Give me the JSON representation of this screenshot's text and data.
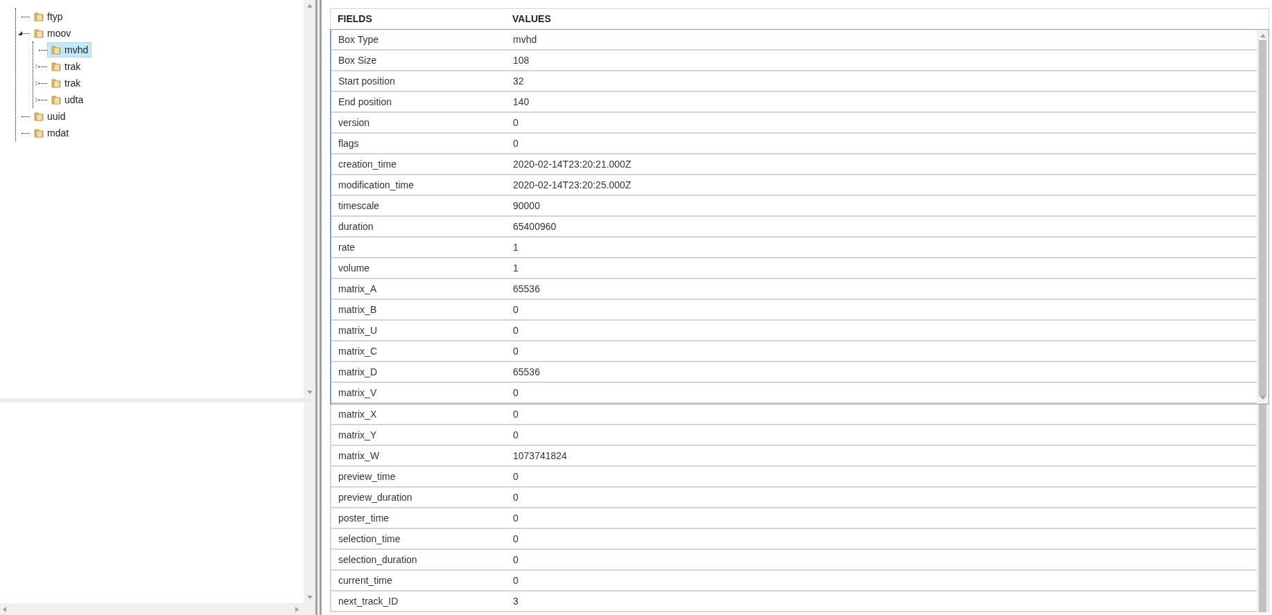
{
  "tree": [
    {
      "label": "ftyp",
      "selected": false
    },
    {
      "label": "moov",
      "selected": false,
      "expanded": true,
      "children": [
        {
          "label": "mvhd",
          "selected": true
        },
        {
          "label": "trak",
          "selected": false,
          "expanded": false
        },
        {
          "label": "trak",
          "selected": false,
          "expanded": false
        },
        {
          "label": "udta",
          "selected": false,
          "expanded": false
        }
      ]
    },
    {
      "label": "uuid",
      "selected": false
    },
    {
      "label": "mdat",
      "selected": false
    }
  ],
  "table": {
    "columns": [
      "FIELDS",
      "VALUES"
    ],
    "rows": [
      [
        "Box Type",
        "mvhd"
      ],
      [
        "Box Size",
        "108"
      ],
      [
        "Start position",
        "32"
      ],
      [
        "End position",
        "140"
      ],
      [
        "version",
        "0"
      ],
      [
        "flags",
        "0"
      ],
      [
        "creation_time",
        "2020-02-14T23:20:21.000Z"
      ],
      [
        "modification_time",
        "2020-02-14T23:20:25.000Z"
      ],
      [
        "timescale",
        "90000"
      ],
      [
        "duration",
        "65400960"
      ],
      [
        "rate",
        "1"
      ],
      [
        "volume",
        "1"
      ],
      [
        "matrix_A",
        "65536"
      ],
      [
        "matrix_B",
        "0"
      ],
      [
        "matrix_U",
        "0"
      ],
      [
        "matrix_C",
        "0"
      ],
      [
        "matrix_D",
        "65536"
      ],
      [
        "matrix_V",
        "0"
      ],
      [
        "matrix_X",
        "0"
      ],
      [
        "matrix_Y",
        "0"
      ],
      [
        "matrix_W",
        "1073741824"
      ],
      [
        "preview_time",
        "0"
      ],
      [
        "preview_duration",
        "0"
      ],
      [
        "poster_time",
        "0"
      ],
      [
        "selection_time",
        "0"
      ],
      [
        "selection_duration",
        "0"
      ],
      [
        "current_time",
        "0"
      ],
      [
        "next_track_ID",
        "3"
      ]
    ]
  }
}
